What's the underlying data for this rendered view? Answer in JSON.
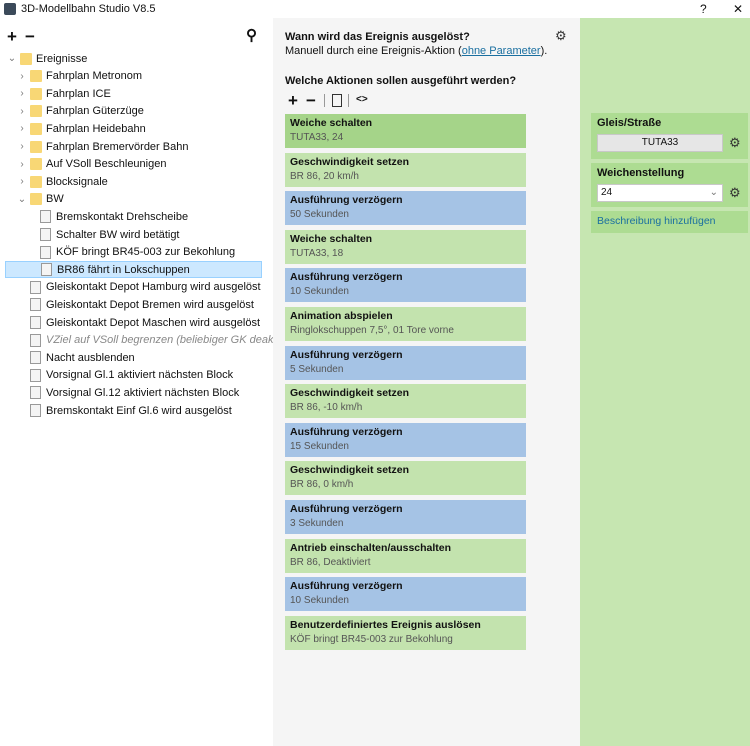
{
  "window": {
    "title": "3D-Modellbahn Studio V8.5",
    "help": "?",
    "close": "✕"
  },
  "tree": {
    "add": "+",
    "remove": "−",
    "search": "⚲",
    "root": "Ereignisse",
    "folders": [
      "Fahrplan Metronom",
      "Fahrplan ICE",
      "Fahrplan Güterzüge",
      "Fahrplan Heidebahn",
      "Fahrplan Bremervörder Bahn",
      "Auf VSoll Beschleunigen",
      "Blocksignale"
    ],
    "bw": {
      "label": "BW",
      "children": [
        "Bremskontakt Drehscheibe",
        "Schalter BW wird betätigt",
        "KÖF bringt BR45-003 zur Bekohlung",
        "BR86 fährt in Lokschuppen"
      ]
    },
    "events": [
      "Gleiskontakt Depot Hamburg wird ausgelöst",
      "Gleiskontakt Depot Bremen wird ausgelöst",
      "Gleiskontakt Depot Maschen wird ausgelöst",
      "VZiel auf VSoll begrenzen (beliebiger GK deaktivier",
      "Nacht ausblenden",
      "Vorsignal Gl.1 aktiviert nächsten Block",
      "Vorsignal Gl.12 aktiviert nächsten Block",
      "Bremskontakt Einf Gl.6 wird ausgelöst"
    ]
  },
  "trigger": {
    "heading": "Wann wird das Ereignis ausgelöst?",
    "text": "Manuell durch eine Ereignis-Aktion (",
    "link": "ohne Parameter",
    "text_end": ")."
  },
  "actions": {
    "heading": "Welche Aktionen sollen ausgeführt werden?",
    "add": "+",
    "remove": "−",
    "code": "<>",
    "items": [
      {
        "title": "Weiche schalten",
        "sub": "TUTA33, 24",
        "kind": "green"
      },
      {
        "title": "Geschwindigkeit setzen",
        "sub": "BR 86, 20 km/h",
        "kind": "green"
      },
      {
        "title": "Ausführung verzögern",
        "sub": "50 Sekunden",
        "kind": "blue"
      },
      {
        "title": "Weiche schalten",
        "sub": "TUTA33, 18",
        "kind": "green"
      },
      {
        "title": "Ausführung verzögern",
        "sub": "10 Sekunden",
        "kind": "blue"
      },
      {
        "title": "Animation abspielen",
        "sub": "Ringlokschuppen 7,5°, 01 Tore vorne",
        "kind": "green"
      },
      {
        "title": "Ausführung verzögern",
        "sub": "5 Sekunden",
        "kind": "blue"
      },
      {
        "title": "Geschwindigkeit setzen",
        "sub": "BR 86, -10 km/h",
        "kind": "green"
      },
      {
        "title": "Ausführung verzögern",
        "sub": "15 Sekunden",
        "kind": "blue"
      },
      {
        "title": "Geschwindigkeit setzen",
        "sub": "BR 86, 0 km/h",
        "kind": "green"
      },
      {
        "title": "Ausführung verzögern",
        "sub": "3 Sekunden",
        "kind": "blue"
      },
      {
        "title": "Antrieb einschalten/ausschalten",
        "sub": "BR 86, Deaktiviert",
        "kind": "green"
      },
      {
        "title": "Ausführung verzögern",
        "sub": "10 Sekunden",
        "kind": "blue"
      },
      {
        "title": "Benutzerdefiniertes Ereignis auslösen",
        "sub": "KÖF bringt BR45-003 zur Bekohlung",
        "kind": "green"
      }
    ]
  },
  "props": {
    "track_label": "Gleis/Straße",
    "track_value": "TUTA33",
    "switch_label": "Weichenstellung",
    "switch_value": "24",
    "add_desc": "Beschreibung hinzufügen"
  }
}
